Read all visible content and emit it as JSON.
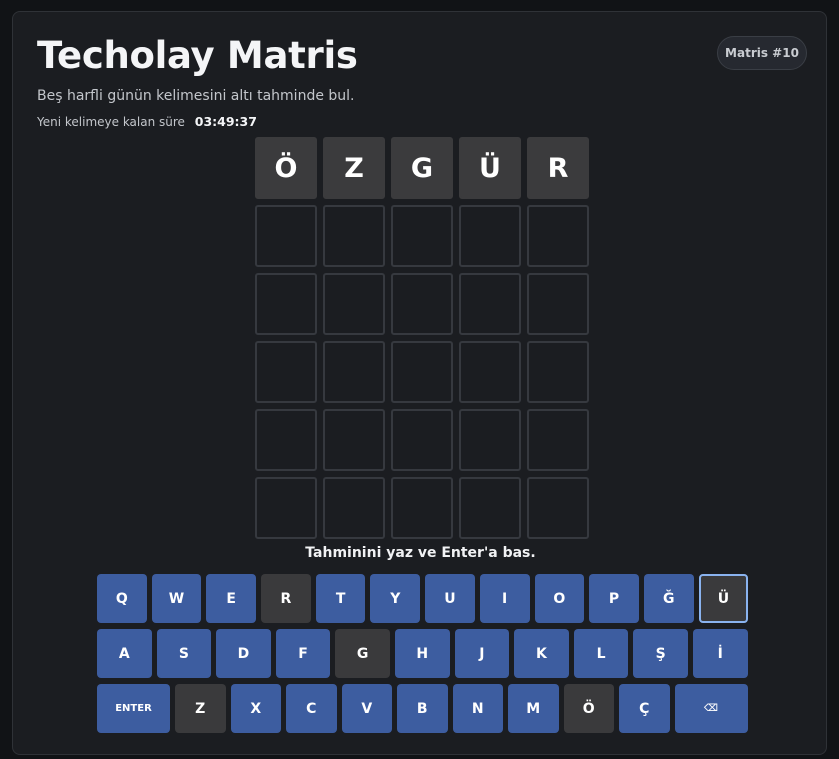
{
  "header": {
    "title": "Techolay Matris",
    "subtitle": "Beş harfli günün kelimesini altı tahminde bul.",
    "timer_label": "Yeni kelimeye kalan süre",
    "timer_value": "03:49:37",
    "badge": "Matris #10"
  },
  "board": {
    "rows": [
      [
        "Ö",
        "Z",
        "G",
        "Ü",
        "R"
      ],
      [
        "",
        "",
        "",
        "",
        ""
      ],
      [
        "",
        "",
        "",
        "",
        ""
      ],
      [
        "",
        "",
        "",
        "",
        ""
      ],
      [
        "",
        "",
        "",
        "",
        ""
      ],
      [
        "",
        "",
        "",
        "",
        ""
      ]
    ],
    "filled_color": "#3b3b3d",
    "empty_border_color": "#36393f"
  },
  "hint": "Tahminini yaz ve Enter'a bas.",
  "keyboard": {
    "rows": [
      [
        {
          "label": "Q",
          "state": "unused"
        },
        {
          "label": "W",
          "state": "unused"
        },
        {
          "label": "E",
          "state": "unused"
        },
        {
          "label": "R",
          "state": "absent"
        },
        {
          "label": "T",
          "state": "unused"
        },
        {
          "label": "Y",
          "state": "unused"
        },
        {
          "label": "U",
          "state": "unused"
        },
        {
          "label": "I",
          "state": "unused"
        },
        {
          "label": "O",
          "state": "unused"
        },
        {
          "label": "P",
          "state": "unused"
        },
        {
          "label": "Ğ",
          "state": "unused"
        },
        {
          "label": "Ü",
          "state": "absent",
          "focused": true
        }
      ],
      [
        {
          "label": "A",
          "state": "unused"
        },
        {
          "label": "S",
          "state": "unused"
        },
        {
          "label": "D",
          "state": "unused"
        },
        {
          "label": "F",
          "state": "unused"
        },
        {
          "label": "G",
          "state": "absent"
        },
        {
          "label": "H",
          "state": "unused"
        },
        {
          "label": "J",
          "state": "unused"
        },
        {
          "label": "K",
          "state": "unused"
        },
        {
          "label": "L",
          "state": "unused"
        },
        {
          "label": "Ş",
          "state": "unused"
        },
        {
          "label": "İ",
          "state": "unused"
        }
      ],
      [
        {
          "label": "ENTER",
          "state": "unused",
          "kind": "enter"
        },
        {
          "label": "Z",
          "state": "absent"
        },
        {
          "label": "X",
          "state": "unused"
        },
        {
          "label": "C",
          "state": "unused"
        },
        {
          "label": "V",
          "state": "unused"
        },
        {
          "label": "B",
          "state": "unused"
        },
        {
          "label": "N",
          "state": "unused"
        },
        {
          "label": "M",
          "state": "unused"
        },
        {
          "label": "Ö",
          "state": "absent"
        },
        {
          "label": "Ç",
          "state": "unused"
        },
        {
          "label": "⌫",
          "state": "unused",
          "kind": "backspace",
          "icon": "backspace-icon"
        }
      ]
    ],
    "colors": {
      "unused": "#3d5da0",
      "absent": "#3a3a3c",
      "focus_ring": "#8ab3ef"
    }
  }
}
